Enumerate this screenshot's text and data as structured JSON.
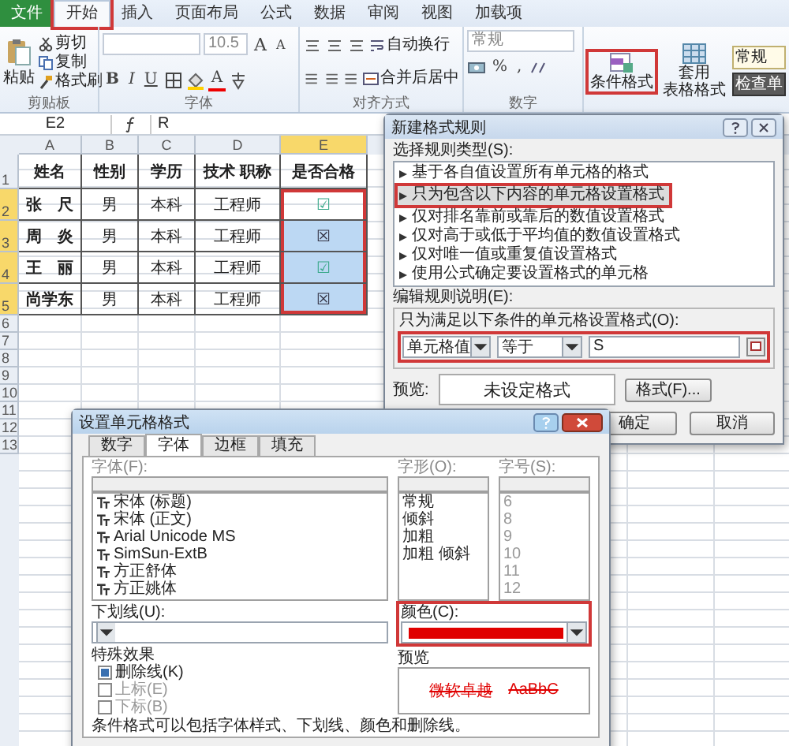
{
  "ribbon_tabs": [
    {
      "label": "文件",
      "kind": "file",
      "selected": false,
      "annotated": false
    },
    {
      "label": "开始",
      "kind": "tab",
      "selected": true,
      "annotated": true
    },
    {
      "label": "插入",
      "kind": "tab",
      "selected": false,
      "annotated": false
    },
    {
      "label": "页面布局",
      "kind": "tab",
      "selected": false,
      "annotated": false
    },
    {
      "label": "公式",
      "kind": "tab",
      "selected": false,
      "annotated": false
    },
    {
      "label": "数据",
      "kind": "tab",
      "selected": false,
      "annotated": false
    },
    {
      "label": "审阅",
      "kind": "tab",
      "selected": false,
      "annotated": false
    },
    {
      "label": "视图",
      "kind": "tab",
      "selected": false,
      "annotated": false
    },
    {
      "label": "加载项",
      "kind": "tab",
      "selected": false,
      "annotated": false
    }
  ],
  "ribbon": {
    "clipboard": {
      "paste": "粘贴",
      "cut": "剪切",
      "copy": "复制",
      "format_painter": "格式刷",
      "label": "剪贴板"
    },
    "font": {
      "size": "10.5",
      "grow": "A",
      "shrink": "A",
      "buttons": [
        "B",
        "I",
        "U"
      ],
      "font_color": "A",
      "label": "字体"
    },
    "alignment": {
      "wrap": "自动换行",
      "merge": "合并后居中",
      "label": "对齐方式"
    },
    "number": {
      "format": "常规",
      "percent": "%",
      "comma": ",",
      "label": "数字"
    },
    "styles": {
      "conditional": "条件格式",
      "conditional_annotated": true,
      "table_lines": [
        "套用",
        "表格格式"
      ],
      "cell_styles": [
        "常规",
        "检查单"
      ]
    }
  },
  "formula_bar": {
    "name_box": "E2",
    "formula": "R"
  },
  "sheet": {
    "columns": [
      {
        "label": "A",
        "selected": false
      },
      {
        "label": "B",
        "selected": false
      },
      {
        "label": "C",
        "selected": false
      },
      {
        "label": "D",
        "selected": false
      },
      {
        "label": "E",
        "selected": true
      }
    ],
    "row_numbers": [
      "1",
      "2",
      "3",
      "4",
      "5",
      "6",
      "7",
      "8",
      "9",
      "10",
      "11",
      "12",
      "13"
    ],
    "headers": [
      "姓名",
      "性别",
      "学历",
      "技术 职称",
      "是否合格"
    ],
    "selection_annotated": true,
    "rows": [
      {
        "cells": [
          "张　尺",
          "男",
          "本科",
          "工程师",
          "☑"
        ],
        "color": "#3aa88a",
        "in_range": true,
        "highlighted": false
      },
      {
        "cells": [
          "周　炎",
          "男",
          "本科",
          "工程师",
          "☒"
        ],
        "color": "#333344",
        "in_range": true,
        "highlighted": true
      },
      {
        "cells": [
          "王　丽",
          "男",
          "本科",
          "工程师",
          "☑"
        ],
        "color": "#3aa88a",
        "in_range": true,
        "highlighted": true
      },
      {
        "cells": [
          "尚学东",
          "男",
          "本科",
          "工程师",
          "☒"
        ],
        "color": "#333344",
        "in_range": true,
        "highlighted": true
      }
    ]
  },
  "rule_dialog": {
    "title": "新建格式规则",
    "type_label": "选择规则类型(S):",
    "rule_types": [
      {
        "label": "基于各自值设置所有单元格的格式",
        "selected": false,
        "annotated": false
      },
      {
        "label": "只为包含以下内容的单元格设置格式",
        "selected": true,
        "annotated": true
      },
      {
        "label": "仅对排名靠前或靠后的数值设置格式",
        "selected": false,
        "annotated": false
      },
      {
        "label": "仅对高于或低于平均值的数值设置格式",
        "selected": false,
        "annotated": false
      },
      {
        "label": "仅对唯一值或重复值设置格式",
        "selected": false,
        "annotated": false
      },
      {
        "label": "使用公式确定要设置格式的单元格",
        "selected": false,
        "annotated": false
      }
    ],
    "edit_label": "编辑规则说明(E):",
    "condition_label": "只为满足以下条件的单元格设置格式(O):",
    "condition": {
      "annotated": true,
      "field": "单元格值",
      "operator": "等于",
      "value": "S"
    },
    "preview_label": "预览:",
    "preview": "未设定格式",
    "format_button": "格式(F)...",
    "ok": "确定",
    "cancel": "取消"
  },
  "format_dialog": {
    "title": "设置单元格格式",
    "tabs": [
      {
        "label": "数字",
        "selected": false
      },
      {
        "label": "字体",
        "selected": true
      },
      {
        "label": "边框",
        "selected": false
      },
      {
        "label": "填充",
        "selected": false
      }
    ],
    "font_label": "字体(F):",
    "fonts": [
      "宋体 (标题)",
      "宋体 (正文)",
      "Arial Unicode MS",
      "SimSun-ExtB",
      "方正舒体",
      "方正姚体"
    ],
    "style_label": "字形(O):",
    "styles": [
      "常规",
      "倾斜",
      "加粗",
      "加粗 倾斜"
    ],
    "size_label": "字号(S):",
    "size_disabled": true,
    "sizes": [
      "6",
      "8",
      "9",
      "10",
      "11",
      "12"
    ],
    "underline_label": "下划线(U):",
    "color_label": "颜色(C):",
    "color": "#e00000",
    "color_annotated": true,
    "effects_label": "特殊效果",
    "effects": [
      {
        "label": "删除线(K)",
        "checked": true,
        "disabled": false
      },
      {
        "label": "上标(E)",
        "checked": false,
        "disabled": true
      },
      {
        "label": "下标(B)",
        "checked": false,
        "disabled": true
      }
    ],
    "preview_label": "预览",
    "preview_samples": [
      "微软卓越",
      "AaBbC"
    ],
    "note": "条件格式可以包括字体样式、下划线、颜色和删除线。"
  }
}
